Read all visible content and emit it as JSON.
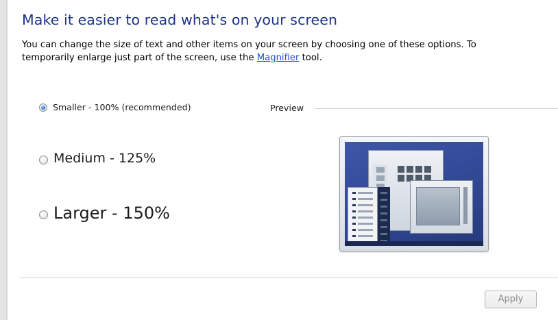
{
  "page": {
    "title": "Make it easier to read what's on your screen",
    "description_line1": "You can change the size of text and other items on your screen by choosing one of these options. To",
    "description_line2_prefix": "temporarily enlarge just part of the screen, use the ",
    "magnifier_link": "Magnifier",
    "description_line2_suffix": " tool."
  },
  "options": [
    {
      "label": "Smaller - 100% (recommended)",
      "selected": true
    },
    {
      "label": "Medium - 125%",
      "selected": false
    },
    {
      "label": "Larger - 150%",
      "selected": false
    }
  ],
  "preview": {
    "label": "Preview",
    "image": "desktop-preview-thumbnail"
  },
  "footer": {
    "apply_label": "Apply",
    "apply_enabled": false
  },
  "colors": {
    "title": "#1e3287",
    "link": "#1a4fc7",
    "preview_background": "#2f4693"
  }
}
